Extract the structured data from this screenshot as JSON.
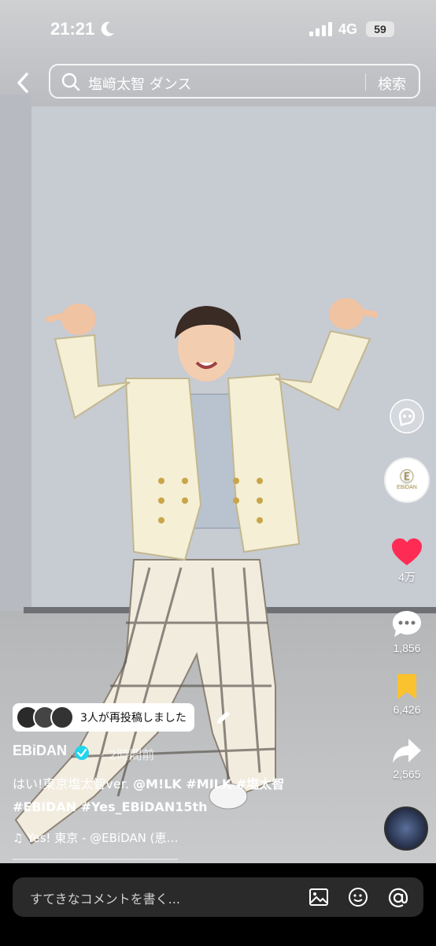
{
  "status": {
    "time": "21:21",
    "network": "4G",
    "battery": "59"
  },
  "search": {
    "query": "塩﨑太智 ダンス",
    "button": "検索"
  },
  "rail": {
    "like_count": "4万",
    "comment_count": "1,856",
    "bookmark_count": "6,426",
    "share_count": "2,565",
    "avatar_text": "EBiDAN",
    "like_color": "#fe2c55",
    "bookmark_color": "#fbc22f"
  },
  "post": {
    "repost_text": "3人が再投稿しました",
    "author": "EBiDAN",
    "posted": "· 2時間前",
    "caption_line1_pre": "はい!東京塩太智ver. ",
    "caption_line1_tags": "@M!LK #MILK #塩太智",
    "caption_line2": "#EBiDAN #Yes_EBiDAN15th",
    "music": "♫ Yes! 東京 - @EBiDAN (恵…"
  },
  "comment": {
    "placeholder": "すてきなコメントを書く..."
  }
}
